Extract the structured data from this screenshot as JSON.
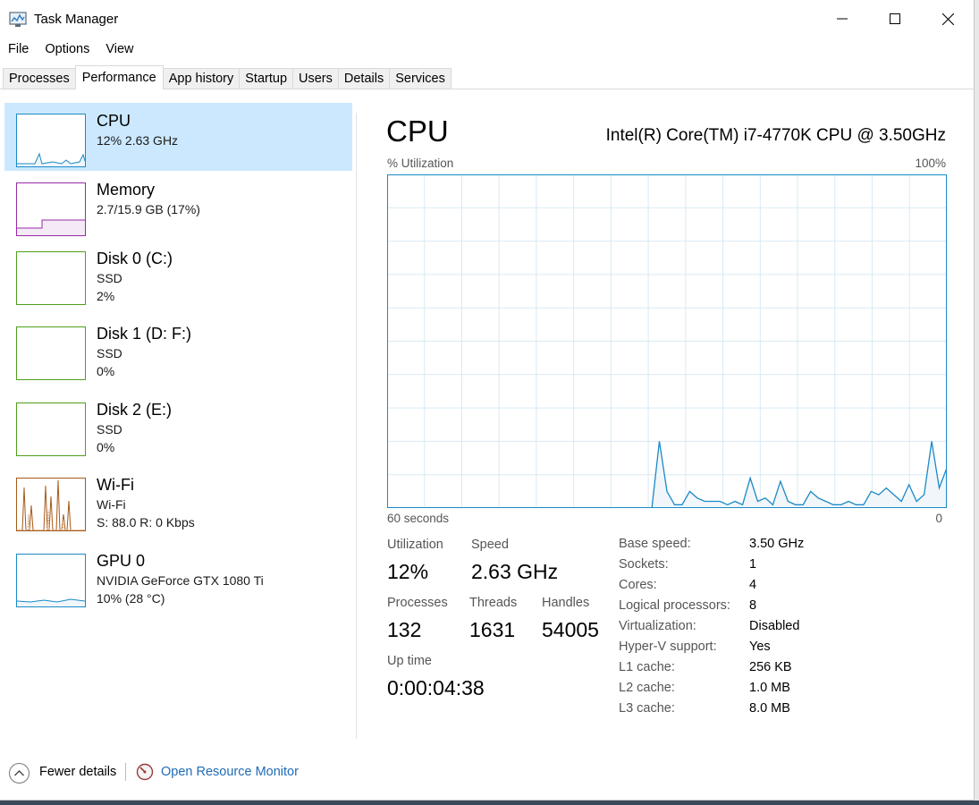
{
  "window": {
    "title": "Task Manager"
  },
  "menu": [
    "File",
    "Options",
    "View"
  ],
  "tabs": [
    {
      "label": "Processes",
      "active": false
    },
    {
      "label": "Performance",
      "active": true
    },
    {
      "label": "App history",
      "active": false
    },
    {
      "label": "Startup",
      "active": false
    },
    {
      "label": "Users",
      "active": false
    },
    {
      "label": "Details",
      "active": false
    },
    {
      "label": "Services",
      "active": false
    }
  ],
  "sidebar": {
    "items": [
      {
        "name": "CPU",
        "lines": [
          "12%  2.63 GHz"
        ],
        "color": "#1a8ac7",
        "selected": true
      },
      {
        "name": "Memory",
        "lines": [
          "2.7/15.9 GB (17%)"
        ],
        "color": "#9a2aa8",
        "selected": false
      },
      {
        "name": "Disk 0 (C:)",
        "lines": [
          "SSD",
          "2%"
        ],
        "color": "#4da01b",
        "selected": false
      },
      {
        "name": "Disk 1 (D: F:)",
        "lines": [
          "SSD",
          "0%"
        ],
        "color": "#4da01b",
        "selected": false
      },
      {
        "name": "Disk 2 (E:)",
        "lines": [
          "SSD",
          "0%"
        ],
        "color": "#4da01b",
        "selected": false
      },
      {
        "name": "Wi-Fi",
        "lines": [
          "Wi-Fi",
          "S: 88.0  R: 0 Kbps"
        ],
        "color": "#a75a17",
        "selected": false
      },
      {
        "name": "GPU 0",
        "lines": [
          "NVIDIA GeForce GTX 1080 Ti",
          "10%  (28 °C)"
        ],
        "color": "#1a8ac7",
        "selected": false
      }
    ]
  },
  "main": {
    "title": "CPU",
    "cpu_model": "Intel(R) Core(TM) i7-4770K CPU @ 3.50GHz",
    "graph": {
      "y_label": "% Utilization",
      "y_max_label": "100%",
      "x_left_label": "60 seconds",
      "x_right_label": "0",
      "line_color": "#1a8ac7",
      "fill_color": "#f1f6fa",
      "grid_color": "#d9eaf4"
    },
    "stats": {
      "utilization": {
        "label": "Utilization",
        "value": "12%"
      },
      "speed": {
        "label": "Speed",
        "value": "2.63 GHz"
      },
      "processes": {
        "label": "Processes",
        "value": "132"
      },
      "threads": {
        "label": "Threads",
        "value": "1631"
      },
      "handles": {
        "label": "Handles",
        "value": "54005"
      },
      "uptime": {
        "label": "Up time",
        "value": "0:00:04:38"
      }
    },
    "specs": [
      {
        "key": "Base speed:",
        "value": "3.50 GHz"
      },
      {
        "key": "Sockets:",
        "value": "1"
      },
      {
        "key": "Cores:",
        "value": "4"
      },
      {
        "key": "Logical processors:",
        "value": "8"
      },
      {
        "key": "Virtualization:",
        "value": "Disabled"
      },
      {
        "key": "Hyper-V support:",
        "value": "Yes"
      },
      {
        "key": "L1 cache:",
        "value": "256 KB"
      },
      {
        "key": "L2 cache:",
        "value": "1.0 MB"
      },
      {
        "key": "L3 cache:",
        "value": "8.0 MB"
      }
    ]
  },
  "footer": {
    "fewer_details": "Fewer details",
    "open_resource_monitor": "Open Resource Monitor"
  },
  "chart_data": {
    "type": "area",
    "xlabel": "60 seconds",
    "ylabel": "% Utilization",
    "ylim": [
      0,
      100
    ],
    "x": [
      60,
      59,
      58,
      57,
      56,
      55,
      54,
      53,
      52,
      51,
      50,
      49,
      48,
      47,
      46,
      45,
      44,
      43,
      42,
      41,
      40,
      39,
      38,
      37,
      36,
      35,
      34,
      33,
      32,
      31,
      30,
      29,
      28,
      27,
      26,
      25,
      24,
      23,
      22,
      21,
      20,
      19,
      18,
      17,
      16,
      15,
      14,
      13,
      12,
      11,
      10,
      9,
      8,
      7,
      6,
      5,
      4,
      3,
      2,
      1,
      0
    ],
    "series": [
      {
        "values": [
          0,
          0,
          0,
          0,
          0,
          0,
          0,
          0,
          0,
          0,
          0,
          0,
          0,
          0,
          0,
          0,
          0,
          0,
          0,
          0,
          0,
          0,
          0,
          0,
          0,
          0,
          0,
          0,
          0,
          0,
          0,
          0,
          0,
          0,
          0,
          0,
          20,
          5,
          1,
          1,
          5,
          3,
          2,
          2,
          2,
          1,
          2,
          1,
          9,
          2,
          3,
          1,
          8,
          2,
          1,
          1,
          5,
          3,
          2,
          1,
          1,
          2,
          1,
          1,
          5,
          4,
          6,
          4,
          2,
          7,
          2,
          4,
          20,
          6,
          12
        ]
      }
    ]
  }
}
